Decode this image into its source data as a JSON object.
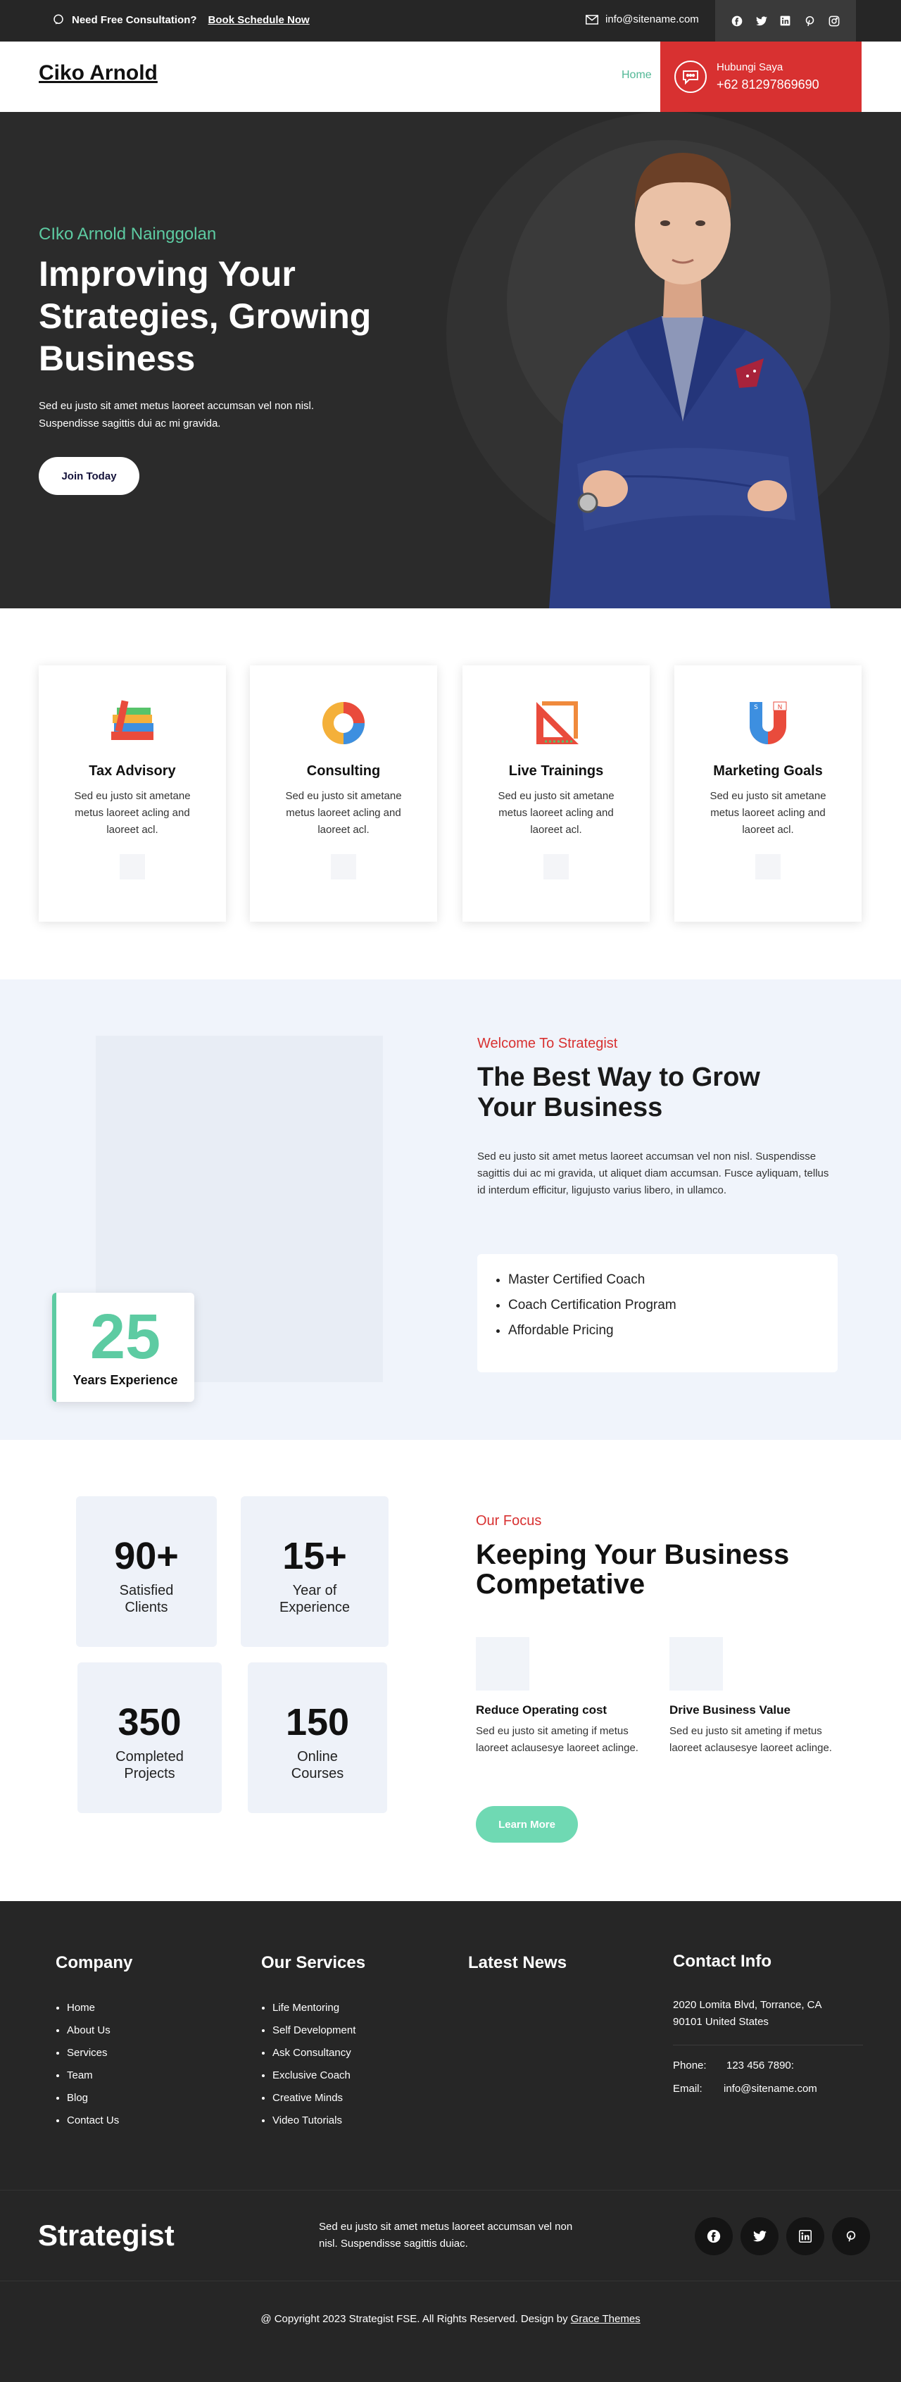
{
  "topbar": {
    "consult_text": "Need Free Consultation?",
    "consult_link": "Book Schedule Now",
    "email": "info@sitename.com",
    "socials": [
      "facebook-icon",
      "twitter-icon",
      "linkedin-icon",
      "pinterest-icon",
      "instagram-icon"
    ]
  },
  "header": {
    "logo": "Ciko Arnold",
    "nav_home": "Home",
    "call_label": "Hubungi Saya",
    "call_number": "+62 81297869690"
  },
  "hero": {
    "subtitle": "CIko Arnold Nainggolan",
    "title": "Improving Your Strategies, Growing Business",
    "desc": "Sed eu justo sit amet metus laoreet accumsan vel non nisl. Suspendisse sagittis dui ac mi gravida.",
    "button": "Join Today"
  },
  "services": [
    {
      "title": "Tax Advisory",
      "desc": "Sed eu justo sit ametane metus laoreet acling and laoreet acl.",
      "icon": "books-icon"
    },
    {
      "title": "Consulting",
      "desc": "Sed eu justo sit ametane metus laoreet acling and laoreet acl.",
      "icon": "pie-chart-icon"
    },
    {
      "title": "Live Trainings",
      "desc": "Sed eu justo sit ametane metus laoreet acling and laoreet acl.",
      "icon": "ruler-triangle-icon"
    },
    {
      "title": "Marketing Goals",
      "desc": "Sed eu justo sit ametane metus laoreet acling and laoreet acl.",
      "icon": "magnet-icon"
    }
  ],
  "about": {
    "exp_number": "25",
    "exp_label": "Years Experience",
    "eyebrow": "Welcome To Strategist",
    "title": "The Best Way to Grow Your Business",
    "desc": "Sed eu justo sit amet metus laoreet accumsan vel non nisl. Suspendisse sagittis dui ac mi gravida, ut aliquet diam accumsan. Fusce ayliquam, tellus id interdum efficitur, ligujusto varius libero, in ullamco.",
    "list": [
      "Master Certified Coach",
      "Coach Certification Program",
      "Affordable Pricing"
    ]
  },
  "focus": {
    "stats": [
      {
        "number": "90+",
        "label": "Satisfied Clients"
      },
      {
        "number": "15+",
        "label": "Year of Experience"
      },
      {
        "number": "350",
        "label": "Completed Projects"
      },
      {
        "number": "150",
        "label": "Online Courses"
      }
    ],
    "eyebrow": "Our Focus",
    "title": "Keeping Your Business Competative",
    "items": [
      {
        "title": "Reduce Operating cost",
        "desc": "Sed eu justo sit ameting if metus laoreet aclausesye laoreet aclinge."
      },
      {
        "title": "Drive Business Value",
        "desc": "Sed eu justo sit ameting if metus laoreet aclausesye laoreet aclinge."
      }
    ],
    "button": "Learn More"
  },
  "footer": {
    "company_title": "Company",
    "company_links": [
      "Home",
      "About Us",
      "Services",
      "Team",
      "Blog",
      "Contact Us"
    ],
    "services_title": "Our Services",
    "services_links": [
      "Life Mentoring",
      "Self Development",
      "Ask Consultancy",
      "Exclusive Coach",
      "Creative Minds",
      "Video Tutorials"
    ],
    "news_title": "Latest News",
    "contact_title": "Contact Info",
    "address": "2020 Lomita Blvd, Torrance, CA 90101 United States",
    "phone_label": "Phone:",
    "phone": "123 456 7890:",
    "email_label": "Email:",
    "email": "info@sitename.com",
    "brand": "Strategist",
    "brand_text": "Sed eu justo sit amet metus laoreet accumsan vel non nisl. Suspendisse sagittis duiac.",
    "socials": [
      "facebook-icon",
      "twitter-icon",
      "linkedin-icon",
      "pinterest-icon"
    ],
    "copyright": "@ Copyright 2023 Strategist FSE. All Rights Reserved. Design by",
    "designer": "Grace Themes"
  },
  "colors": {
    "accent_green": "#5dcba2",
    "accent_red": "#d83131",
    "dark_bg": "#2b2b2b"
  }
}
